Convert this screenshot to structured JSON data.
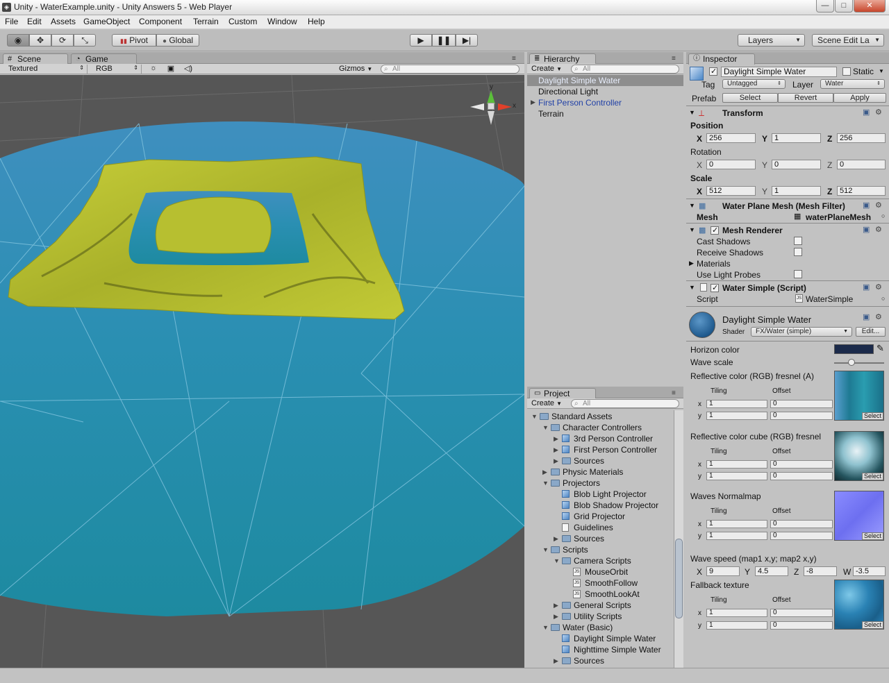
{
  "window": {
    "title": "Unity - WaterExample.unity - Unity Answers 5 - Web Player",
    "controls": {
      "minimize": "—",
      "maximize": "□",
      "close": "✕"
    }
  },
  "menu": [
    "File",
    "Edit",
    "Assets",
    "GameObject",
    "Component",
    "Terrain",
    "Custom",
    "Window",
    "Help"
  ],
  "toolbar": {
    "tools": [
      "view-tool",
      "move-tool",
      "rotate-tool",
      "scale-tool"
    ],
    "pivot_label": "Pivot",
    "global_label": "Global",
    "layers_label": "Layers",
    "layout_label": "Scene Edit La"
  },
  "scene": {
    "tabs": [
      "Scene",
      "Game"
    ],
    "render_mode": "Textured",
    "color_mode": "RGB",
    "gizmos_label": "Gizmos",
    "search_placeholder": "All",
    "gizmo_axes": {
      "y": "y",
      "x": "x"
    }
  },
  "hierarchy": {
    "tab": "Hierarchy",
    "create_label": "Create",
    "search_placeholder": "All",
    "items": [
      "Daylight Simple Water",
      "Directional Light",
      "First Person Controller",
      "Terrain"
    ],
    "selected_index": 0
  },
  "project": {
    "tab": "Project",
    "create_label": "Create",
    "search_placeholder": "All",
    "tree": [
      {
        "label": "Standard Assets",
        "depth": 0,
        "type": "folder",
        "expanded": true
      },
      {
        "label": "Character Controllers",
        "depth": 1,
        "type": "folder",
        "expanded": true
      },
      {
        "label": "3rd Person Controller",
        "depth": 2,
        "type": "prefab",
        "expandable": true
      },
      {
        "label": "First Person Controller",
        "depth": 2,
        "type": "prefab",
        "expandable": true
      },
      {
        "label": "Sources",
        "depth": 2,
        "type": "folder",
        "expandable": true
      },
      {
        "label": "Physic Materials",
        "depth": 1,
        "type": "folder",
        "expandable": true
      },
      {
        "label": "Projectors",
        "depth": 1,
        "type": "folder",
        "expanded": true
      },
      {
        "label": "Blob Light Projector",
        "depth": 2,
        "type": "prefab"
      },
      {
        "label": "Blob Shadow Projector",
        "depth": 2,
        "type": "prefab"
      },
      {
        "label": "Grid Projector",
        "depth": 2,
        "type": "prefab"
      },
      {
        "label": "Guidelines",
        "depth": 2,
        "type": "doc"
      },
      {
        "label": "Sources",
        "depth": 2,
        "type": "folder",
        "expandable": true
      },
      {
        "label": "Scripts",
        "depth": 1,
        "type": "folder",
        "expanded": true
      },
      {
        "label": "Camera Scripts",
        "depth": 2,
        "type": "folder",
        "expanded": true
      },
      {
        "label": "MouseOrbit",
        "depth": 3,
        "type": "script"
      },
      {
        "label": "SmoothFollow",
        "depth": 3,
        "type": "script"
      },
      {
        "label": "SmoothLookAt",
        "depth": 3,
        "type": "script"
      },
      {
        "label": "General Scripts",
        "depth": 2,
        "type": "folder",
        "expandable": true
      },
      {
        "label": "Utility Scripts",
        "depth": 2,
        "type": "folder",
        "expandable": true
      },
      {
        "label": "Water (Basic)",
        "depth": 1,
        "type": "folder",
        "expanded": true
      },
      {
        "label": "Daylight Simple Water",
        "depth": 2,
        "type": "prefab"
      },
      {
        "label": "Nighttime Simple Water",
        "depth": 2,
        "type": "prefab"
      },
      {
        "label": "Sources",
        "depth": 2,
        "type": "folder",
        "expandable": true
      }
    ]
  },
  "inspector": {
    "tab": "Inspector",
    "object_name": "Daylight Simple Water",
    "static_label": "Static",
    "tag_label": "Tag",
    "tag_value": "Untagged",
    "layer_label": "Layer",
    "layer_value": "Water",
    "prefab_label": "Prefab",
    "prefab_buttons": [
      "Select",
      "Revert",
      "Apply"
    ],
    "transform": {
      "title": "Transform",
      "position_label": "Position",
      "rotation_label": "Rotation",
      "scale_label": "Scale",
      "axes": [
        "X",
        "Y",
        "Z"
      ],
      "position": [
        "256",
        "1",
        "256"
      ],
      "rotation": [
        "0",
        "0",
        "0"
      ],
      "scale": [
        "512",
        "1",
        "512"
      ]
    },
    "mesh_filter": {
      "title": "Water Plane Mesh (Mesh Filter)",
      "mesh_label": "Mesh",
      "mesh_value": "waterPlaneMesh"
    },
    "mesh_renderer": {
      "title": "Mesh Renderer",
      "cast_shadows": "Cast Shadows",
      "receive_shadows": "Receive Shadows",
      "materials": "Materials",
      "light_probes": "Use Light Probes"
    },
    "water_script": {
      "title": "Water Simple (Script)",
      "script_label": "Script",
      "script_value": "WaterSimple"
    },
    "material": {
      "name": "Daylight Simple Water",
      "shader_label": "Shader",
      "shader_value": "FX/Water (simple)",
      "edit_label": "Edit...",
      "horizon_color_label": "Horizon color",
      "horizon_color": "#1b2a4a",
      "wave_scale_label": "Wave scale",
      "wave_scale_level": 0.35,
      "tiling_label": "Tiling",
      "offset_label": "Offset",
      "tex_select": "Select",
      "textures": [
        {
          "label": "Reflective color (RGB) fresnel (A)",
          "tiling": [
            "1",
            "1"
          ],
          "offset": [
            "0",
            "0"
          ]
        },
        {
          "label": "Reflective color cube (RGB) fresnel",
          "tiling": [
            "1",
            "1"
          ],
          "offset": [
            "0",
            "0"
          ]
        },
        {
          "label": "Waves Normalmap",
          "tiling": [
            "1",
            "1"
          ],
          "offset": [
            "0",
            "0"
          ]
        }
      ],
      "wave_speed_label": "Wave speed (map1 x,y; map2 x,y)",
      "wave_speed_axes": [
        "X",
        "Y",
        "Z",
        "W"
      ],
      "wave_speed": [
        "9",
        "4.5",
        "-8",
        "-3.5"
      ],
      "fallback_label": "Fallback texture",
      "fallback_tiling": [
        "1",
        "1"
      ],
      "fallback_offset": [
        "0",
        "0"
      ],
      "xy": [
        "x",
        "y"
      ]
    }
  }
}
